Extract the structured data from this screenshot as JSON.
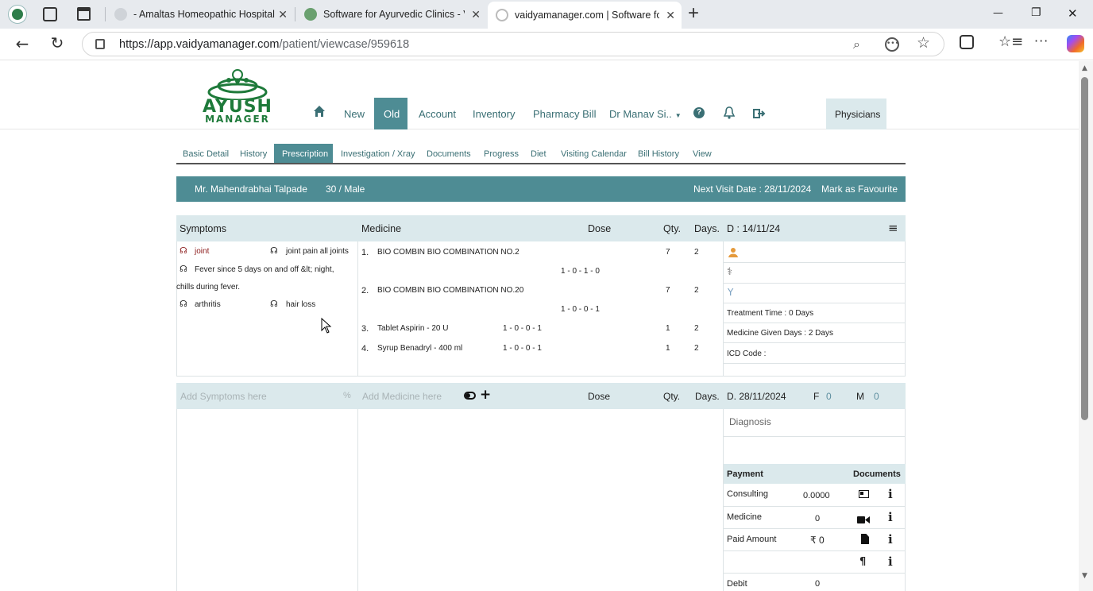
{
  "browser": {
    "tabs": [
      {
        "title": "- Amaltas Homeopathic Hospital",
        "close": "✕"
      },
      {
        "title": "Software for Ayurvedic Clinics - Vaidya",
        "close": "✕"
      },
      {
        "title": "vaidyamanager.com | Software for",
        "close": "✕"
      }
    ],
    "url_host": "https://app.vaidyamanager.com",
    "url_path": "/patient/viewcase/959618",
    "new_tab": "+",
    "window_controls": [
      "—",
      "❐",
      "✕"
    ]
  },
  "app": {
    "logo_line1": "AYUSH",
    "logo_line2": "MANAGER",
    "nav": {
      "new": "New",
      "old": "Old",
      "account": "Account",
      "inventory": "Inventory",
      "pharmacy": "Pharmacy Bill",
      "doctor": "Dr Manav Si..",
      "physicians": "Physicians"
    },
    "subtabs": [
      "Basic Detail",
      "History",
      "Prescription",
      "Investigation / Xray",
      "Documents",
      "Progress",
      "Diet",
      "Visiting Calendar",
      "Bill History",
      "View"
    ],
    "patient": {
      "name": "Mr. Mahendrabhai Talpade",
      "age_sex": "30 / Male",
      "next_visit": "Next Visit Date : 28/11/2024",
      "favourite": "Mark as Favourite"
    },
    "prev": {
      "headers": {
        "symptoms": "Symptoms",
        "medicine": "Medicine",
        "dose": "Dose",
        "qty": "Qty.",
        "days": "Days.",
        "date": "D : 14/11/24"
      },
      "symptoms": [
        "joint",
        "joint pain all joints",
        "Fever since 5 days on and off &lt; night,",
        "chills during fever.",
        "arthritis",
        "hair loss"
      ],
      "medicines": [
        {
          "no": "1.",
          "name": "BIO COMBIN BIO COMBINATION NO.2",
          "dose": "1 - 0 - 1 - 0",
          "qty": "7",
          "days": "2"
        },
        {
          "no": "2.",
          "name": "BIO COMBIN BIO COMBINATION NO.20",
          "dose": "1 - 0 - 0 - 1",
          "qty": "7",
          "days": "2"
        },
        {
          "no": "3.",
          "name": "Tablet Aspirin - 20 U",
          "dose": "1 - 0 - 0 - 1",
          "qty": "1",
          "days": "2"
        },
        {
          "no": "4.",
          "name": "Syrup Benadryl - 400 ml",
          "dose": "1 - 0 - 0 - 1",
          "qty": "1",
          "days": "2"
        }
      ],
      "info": {
        "treatment": "Treatment Time : 0 Days",
        "given": "Medicine Given Days : 2 Days",
        "icd": "ICD Code :"
      }
    },
    "current": {
      "symptoms_placeholder": "Add Symptoms here",
      "percent": "%",
      "medicine_placeholder": "Add Medicine here",
      "dose": "Dose",
      "qty": "Qty.",
      "days": "Days.",
      "date": "D. 28/11/2024",
      "f_label": "F",
      "f_value": "0",
      "m_label": "M",
      "m_value": "0",
      "diagnosis_placeholder": "Diagnosis"
    },
    "payment": {
      "header": "Payment",
      "documents": "Documents",
      "consulting_label": "Consulting",
      "consulting_value": "0.0000",
      "medicine_label": "Medicine",
      "medicine_value": "0",
      "paid_label": "Paid Amount",
      "paid_value": "₹ 0",
      "debit_label": "Debit",
      "debit_value": "0"
    }
  },
  "colors": {
    "teal": "#4e8c94",
    "light_teal": "#dbe9ec",
    "brand_green": "#1e7a3a"
  }
}
